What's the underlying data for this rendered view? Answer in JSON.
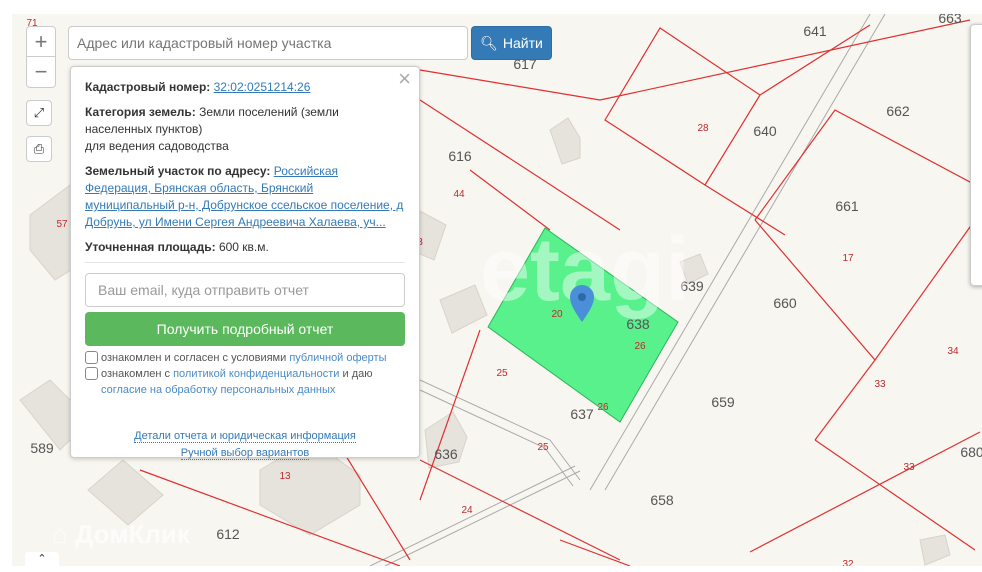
{
  "map": {
    "labels": [
      [
        "641",
        815,
        31
      ],
      [
        "617",
        525,
        64
      ],
      [
        "663",
        950,
        18
      ],
      [
        "662",
        898,
        111
      ],
      [
        "640",
        765,
        131
      ],
      [
        "28",
        703,
        126
      ],
      [
        "616",
        460,
        156
      ],
      [
        "44",
        459,
        192
      ],
      [
        "661",
        847,
        206
      ],
      [
        "17",
        848,
        256
      ],
      [
        "639",
        692,
        286
      ],
      [
        "660",
        785,
        303
      ],
      [
        "638",
        638,
        324
      ],
      [
        "26",
        640,
        344
      ],
      [
        "20",
        557,
        312
      ],
      [
        "34",
        953,
        349
      ],
      [
        "33",
        880,
        382
      ],
      [
        "25",
        502,
        371
      ],
      [
        "637",
        582,
        414
      ],
      [
        "659",
        723,
        402
      ],
      [
        "589",
        42,
        448
      ],
      [
        "636",
        446,
        454
      ],
      [
        "25",
        543,
        445
      ],
      [
        "680",
        972,
        452
      ],
      [
        "33",
        909,
        465
      ],
      [
        "13",
        285,
        474
      ],
      [
        "658",
        662,
        500
      ],
      [
        "24",
        467,
        508
      ],
      [
        "612",
        228,
        534
      ],
      [
        "32",
        848,
        562
      ],
      [
        "57",
        62,
        222
      ],
      [
        "71",
        32,
        21
      ],
      [
        "3",
        420,
        240
      ],
      [
        "26",
        603,
        405
      ]
    ],
    "watermark": "etagi",
    "brand": "ДомКлик"
  },
  "controls": {
    "zoom_in": "+",
    "zoom_out": "−",
    "expand_icon": "expand-icon",
    "print_icon": "print-icon"
  },
  "search": {
    "placeholder": "Адрес или кадастровый номер участка",
    "button": "Найти"
  },
  "popup": {
    "cad_label": "Кадастровый номер:",
    "cad_value": "32:02:0251214:26",
    "cat_label": "Категория земель:",
    "cat_value": "Земли поселений (земли населенных пунктов)",
    "cat_use": "для ведения садоводства",
    "addr_label": "Земельный участок по адресу:",
    "addr_value": "Российская Федерация, Брянская область, Брянский муниципальный р-н, Добрунское ссельское поселение, д Добрунь, ул Имени Сергея Андреевича Халаева, уч...",
    "area_label": "Уточненная площадь:",
    "area_value": "600 кв.м.",
    "email_placeholder": "Ваш email, куда отправить отчет",
    "get_report": "Получить подробный отчет",
    "c1_text": "ознакомлен и согласен с условиями ",
    "c1_link": "публичной оферты",
    "c2_text": "ознакомлен с ",
    "c2_link": "политикой конфиденциальности",
    "c2_mid": " и даю ",
    "c2_link2": "согласие на обработку персональных данных",
    "details": "Детали отчета и юридическая информация",
    "manual": "Ручной выбор вариантов"
  }
}
